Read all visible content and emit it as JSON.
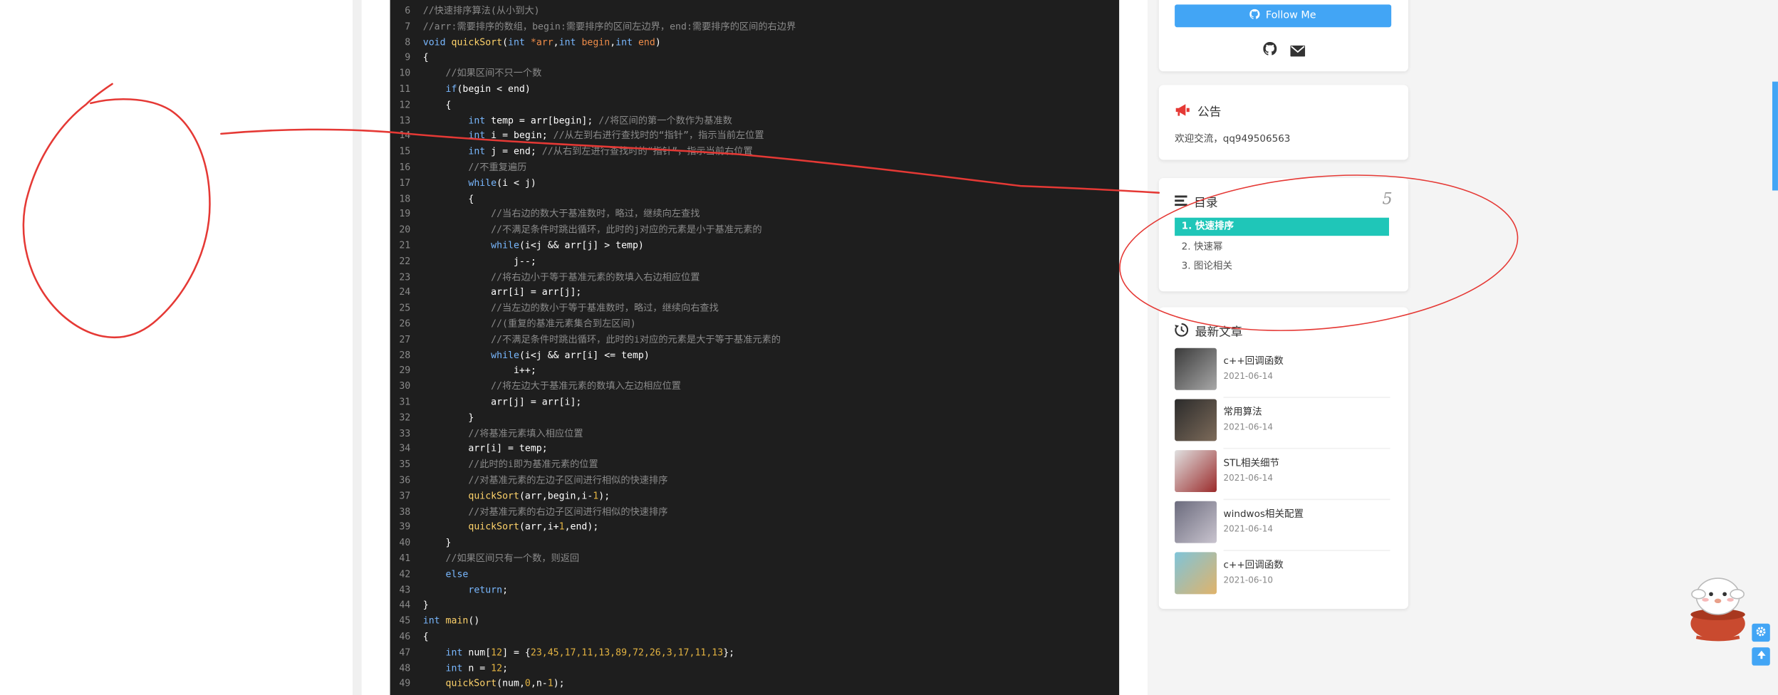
{
  "code": [
    {
      "n": "6",
      "t": [
        [
          "cm",
          "//快速排序算法(从小到大)"
        ]
      ]
    },
    {
      "n": "7",
      "t": [
        [
          "cm",
          "//arr:需要排序的数组，begin:需要排序的区间左边界，end:需要排序的区间的右边界"
        ]
      ]
    },
    {
      "n": "8",
      "t": [
        [
          "kw",
          "void "
        ],
        [
          "fn",
          "quickSort"
        ],
        [
          "tx",
          "("
        ],
        [
          "kw",
          "int "
        ],
        [
          "pm",
          "*arr"
        ],
        [
          "tx",
          ","
        ],
        [
          "kw",
          "int "
        ],
        [
          "pm",
          "begin"
        ],
        [
          "tx",
          ","
        ],
        [
          "kw",
          "int "
        ],
        [
          "pm",
          "end"
        ],
        [
          "tx",
          ")"
        ]
      ]
    },
    {
      "n": "9",
      "t": [
        [
          "tx",
          "{"
        ]
      ]
    },
    {
      "n": "10",
      "t": [
        [
          "cm",
          "    //如果区间不只一个数"
        ]
      ]
    },
    {
      "n": "11",
      "t": [
        [
          "tx",
          "    "
        ],
        [
          "kw",
          "if"
        ],
        [
          "tx",
          "(begin < end)"
        ]
      ]
    },
    {
      "n": "12",
      "t": [
        [
          "tx",
          "    {"
        ]
      ]
    },
    {
      "n": "13",
      "t": [
        [
          "tx",
          "        "
        ],
        [
          "kw",
          "int "
        ],
        [
          "tx",
          "temp = arr[begin]; "
        ],
        [
          "cm",
          "//将区间的第一个数作为基准数"
        ]
      ]
    },
    {
      "n": "14",
      "t": [
        [
          "tx",
          "        "
        ],
        [
          "kw",
          "int "
        ],
        [
          "tx",
          "i = begin; "
        ],
        [
          "cm",
          "//从左到右进行查找时的“指针”，指示当前左位置"
        ]
      ]
    },
    {
      "n": "15",
      "t": [
        [
          "tx",
          "        "
        ],
        [
          "kw",
          "int "
        ],
        [
          "tx",
          "j = end; "
        ],
        [
          "cm",
          "//从右到左进行查找时的“指针”，指示当前右位置"
        ]
      ]
    },
    {
      "n": "16",
      "t": [
        [
          "cm",
          "        //不重复遍历"
        ]
      ]
    },
    {
      "n": "17",
      "t": [
        [
          "tx",
          "        "
        ],
        [
          "kw",
          "while"
        ],
        [
          "tx",
          "(i < j)"
        ]
      ]
    },
    {
      "n": "18",
      "t": [
        [
          "tx",
          "        {"
        ]
      ]
    },
    {
      "n": "19",
      "t": [
        [
          "cm",
          "            //当右边的数大于基准数时，略过，继续向左查找"
        ]
      ]
    },
    {
      "n": "20",
      "t": [
        [
          "cm",
          "            //不满足条件时跳出循环，此时的j对应的元素是小于基准元素的"
        ]
      ]
    },
    {
      "n": "21",
      "t": [
        [
          "tx",
          "            "
        ],
        [
          "kw",
          "while"
        ],
        [
          "tx",
          "(i<j && arr[j] > temp)"
        ]
      ]
    },
    {
      "n": "22",
      "t": [
        [
          "tx",
          "                j--;"
        ]
      ]
    },
    {
      "n": "23",
      "t": [
        [
          "cm",
          "            //将右边小于等于基准元素的数填入右边相应位置"
        ]
      ]
    },
    {
      "n": "24",
      "t": [
        [
          "tx",
          "            arr[i] = arr[j];"
        ]
      ]
    },
    {
      "n": "25",
      "t": [
        [
          "cm",
          "            //当左边的数小于等于基准数时，略过，继续向右查找"
        ]
      ]
    },
    {
      "n": "26",
      "t": [
        [
          "cm",
          "            //(重复的基准元素集合到左区间)"
        ]
      ]
    },
    {
      "n": "27",
      "t": [
        [
          "cm",
          "            //不满足条件时跳出循环，此时的i对应的元素是大于等于基准元素的"
        ]
      ]
    },
    {
      "n": "28",
      "t": [
        [
          "tx",
          "            "
        ],
        [
          "kw",
          "while"
        ],
        [
          "tx",
          "(i<j && arr[i] <= temp)"
        ]
      ]
    },
    {
      "n": "29",
      "t": [
        [
          "tx",
          "                i++;"
        ]
      ]
    },
    {
      "n": "30",
      "t": [
        [
          "cm",
          "            //将左边大于基准元素的数填入左边相应位置"
        ]
      ]
    },
    {
      "n": "31",
      "t": [
        [
          "tx",
          "            arr[j] = arr[i];"
        ]
      ]
    },
    {
      "n": "32",
      "t": [
        [
          "tx",
          "        }"
        ]
      ]
    },
    {
      "n": "33",
      "t": [
        [
          "cm",
          "        //将基准元素填入相应位置"
        ]
      ]
    },
    {
      "n": "34",
      "t": [
        [
          "tx",
          "        arr[i] = temp;"
        ]
      ]
    },
    {
      "n": "35",
      "t": [
        [
          "cm",
          "        //此时的i即为基准元素的位置"
        ]
      ]
    },
    {
      "n": "36",
      "t": [
        [
          "cm",
          "        //对基准元素的左边子区间进行相似的快速排序"
        ]
      ]
    },
    {
      "n": "37",
      "t": [
        [
          "tx",
          "        "
        ],
        [
          "fn",
          "quickSort"
        ],
        [
          "tx",
          "(arr,begin,i-"
        ],
        [
          "nm",
          "1"
        ],
        [
          "tx",
          ");"
        ]
      ]
    },
    {
      "n": "38",
      "t": [
        [
          "cm",
          "        //对基准元素的右边子区间进行相似的快速排序"
        ]
      ]
    },
    {
      "n": "39",
      "t": [
        [
          "tx",
          "        "
        ],
        [
          "fn",
          "quickSort"
        ],
        [
          "tx",
          "(arr,i+"
        ],
        [
          "nm",
          "1"
        ],
        [
          "tx",
          ",end);"
        ]
      ]
    },
    {
      "n": "40",
      "t": [
        [
          "tx",
          "    }"
        ]
      ]
    },
    {
      "n": "41",
      "t": [
        [
          "cm",
          "    //如果区间只有一个数，则返回"
        ]
      ]
    },
    {
      "n": "42",
      "t": [
        [
          "tx",
          "    "
        ],
        [
          "kw",
          "else"
        ]
      ]
    },
    {
      "n": "43",
      "t": [
        [
          "tx",
          "        "
        ],
        [
          "kw",
          "return"
        ],
        [
          "tx",
          ";"
        ]
      ]
    },
    {
      "n": "44",
      "t": [
        [
          "tx",
          "}"
        ]
      ]
    },
    {
      "n": "45",
      "t": [
        [
          "kw",
          "int "
        ],
        [
          "fn",
          "main"
        ],
        [
          "tx",
          "()"
        ]
      ]
    },
    {
      "n": "46",
      "t": [
        [
          "tx",
          "{"
        ]
      ]
    },
    {
      "n": "47",
      "t": [
        [
          "tx",
          "    "
        ],
        [
          "kw",
          "int "
        ],
        [
          "tx",
          "num["
        ],
        [
          "nm",
          "12"
        ],
        [
          "tx",
          "] = {"
        ],
        [
          "nm",
          "23,45,17,11,13,89,72,26,3,17,11,13"
        ],
        [
          "tx",
          "};"
        ]
      ]
    },
    {
      "n": "48",
      "t": [
        [
          "tx",
          "    "
        ],
        [
          "kw",
          "int "
        ],
        [
          "tx",
          "n = "
        ],
        [
          "nm",
          "12"
        ],
        [
          "tx",
          ";"
        ]
      ]
    },
    {
      "n": "49",
      "t": [
        [
          "tx",
          "    "
        ],
        [
          "fn",
          "quickSort"
        ],
        [
          "tx",
          "(num,"
        ],
        [
          "nm",
          "0"
        ],
        [
          "tx",
          ",n-"
        ],
        [
          "nm",
          "1"
        ],
        [
          "tx",
          ");"
        ]
      ]
    }
  ],
  "profile": {
    "follow_label": "Follow Me",
    "links": [
      {
        "icon": "github-icon"
      },
      {
        "icon": "mail-icon"
      }
    ]
  },
  "notice": {
    "title": "公告",
    "icon": "megaphone-icon",
    "text": "欢迎交流，qq949506563"
  },
  "toc": {
    "title": "目录",
    "icon": "list-icon",
    "count": "5",
    "items": [
      "1. 快速排序",
      "2. 快速幂",
      "3. 图论相关"
    ],
    "active_index": 0
  },
  "recent": {
    "title": "最新文章",
    "icon": "history-icon",
    "articles": [
      {
        "title": "c++回调函数",
        "date": "2021-06-14"
      },
      {
        "title": "常用算法",
        "date": "2021-06-14"
      },
      {
        "title": "STL相关细节",
        "date": "2021-06-14"
      },
      {
        "title": "windwos相关配置",
        "date": "2021-06-14"
      },
      {
        "title": "c++回调函数",
        "date": "2021-06-10"
      }
    ]
  },
  "colors": {
    "accent": "#42a5f5",
    "toc_active": "#1fc6b8",
    "annotation": "#e53935",
    "code_bg": "#1e1e1e"
  },
  "float_buttons": [
    {
      "icon": "gear-icon"
    },
    {
      "icon": "arrow-up-icon"
    }
  ]
}
